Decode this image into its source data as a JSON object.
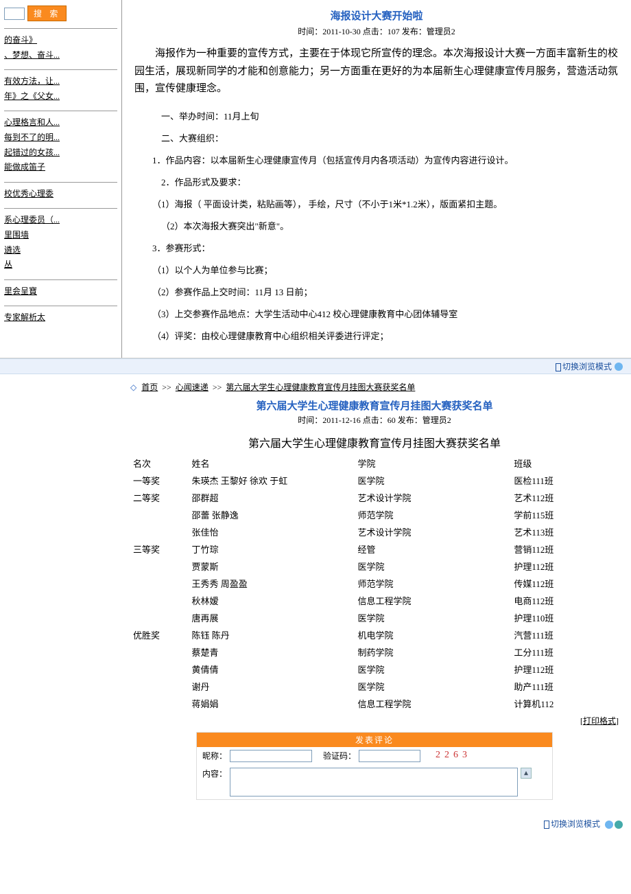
{
  "search": {
    "btn": "搜 索"
  },
  "sidebar": {
    "g1": [
      "的奋斗》",
      "、梦想、奋斗..."
    ],
    "g2": [
      "有效方法，让...",
      "年》之《父女..."
    ],
    "g3": [
      "心理格言和人...",
      "每到不了的明...",
      "起错过的女孩...",
      "能做成笛子"
    ],
    "g4": [
      "校优秀心理委"
    ],
    "g5": [
      "系心理委员（...",
      "里围墙",
      "遴选",
      "丛"
    ],
    "g6": [
      "里会呈寶"
    ],
    "g7": [
      "专家解析太"
    ]
  },
  "article1": {
    "title": "海报设计大赛开始啦",
    "meta": "时间：2011-10-30 点击：107 发布：管理员2",
    "intro": "海报作为一种重要的宣传方式，主要在于体现它所宣传的理念。本次海报设计大赛一方面丰富新生的校园生活，展现新同学的才能和创意能力；另一方面重在更好的为本届新生心理健康宣传月服务，营造活动氛围，宣传健康理念。",
    "paras": [
      "一、举办时间：11月上旬",
      "二、大赛组织：",
      "1．作品内容：以本届新生心理健康宣传月（包括宣传月内各项活动）为宣传内容进行设计。",
      "2．作品形式及要求：",
      "（1）海报（ 平面设计类，粘贴画等）， 手绘，尺寸（不小于1米*1.2米），版面紧扣主题。",
      "（2）本次海报大赛突出\"新意\"。",
      "3．参赛形式：",
      "（1）以个人为单位参与比赛；",
      "（2）参赛作品上交时间：11月 13 日前；",
      "（3）上交参赛作品地点：大学生活动中心412 校心理健康教育中心团体辅导室",
      "（4）评奖：由校心理健康教育中心组织相关评委进行评定；"
    ]
  },
  "switch": "切换浏览模式",
  "crumb": {
    "home": "首页",
    "cat": "心闻速递",
    "title": "第六届大学生心理健康教育宣传月挂图大赛获奖名单"
  },
  "article2": {
    "title": "第六届大学生心理健康教育宣传月挂图大赛获奖名单",
    "meta": "时间：2011-12-16 点击：60 发布：管理员2",
    "big": "第六届大学生心理健康教育宣传月挂图大赛获奖名单",
    "head": [
      "名次",
      "姓名",
      "学院",
      "班级"
    ],
    "rows": [
      [
        "一等奖",
        "朱瑛杰 王黎好 徐欢 于虹",
        "医学院",
        "医检111班"
      ],
      [
        "二等奖",
        "邵群超",
        "艺术设计学院",
        "艺术112班"
      ],
      [
        "",
        "邵蕾 张静逸",
        "师范学院",
        "学前115班"
      ],
      [
        "",
        "张佳怡",
        "艺术设计学院",
        "艺术113班"
      ],
      [
        "三等奖",
        "丁竹琮",
        "经管",
        "营销112班"
      ],
      [
        "",
        "贾蒙斯",
        "医学院",
        "护理112班"
      ],
      [
        "",
        "王秀秀 周盈盈",
        "师范学院",
        "传媒112班"
      ],
      [
        "",
        "秋林嫒",
        "信息工程学院",
        "电商112班"
      ],
      [
        "",
        "唐再展",
        "医学院",
        "护理110班"
      ],
      [
        "优胜奖",
        "陈钰 陈丹",
        "机电学院",
        "汽营111班"
      ],
      [
        "",
        "蔡楚青",
        "制药学院",
        "工分111班"
      ],
      [
        "",
        "黄倩倩",
        "医学院",
        "护理112班"
      ],
      [
        "",
        "谢丹",
        "医学院",
        "助产111班"
      ],
      [
        "",
        "蒋娟娟",
        "信息工程学院",
        "计算机112"
      ]
    ],
    "printfmt": "[打印格式]"
  },
  "comment": {
    "head": "发表评论",
    "nick_l": "昵称：",
    "code_l": "验证码：",
    "code_v": "2263",
    "content_l": "内容："
  }
}
